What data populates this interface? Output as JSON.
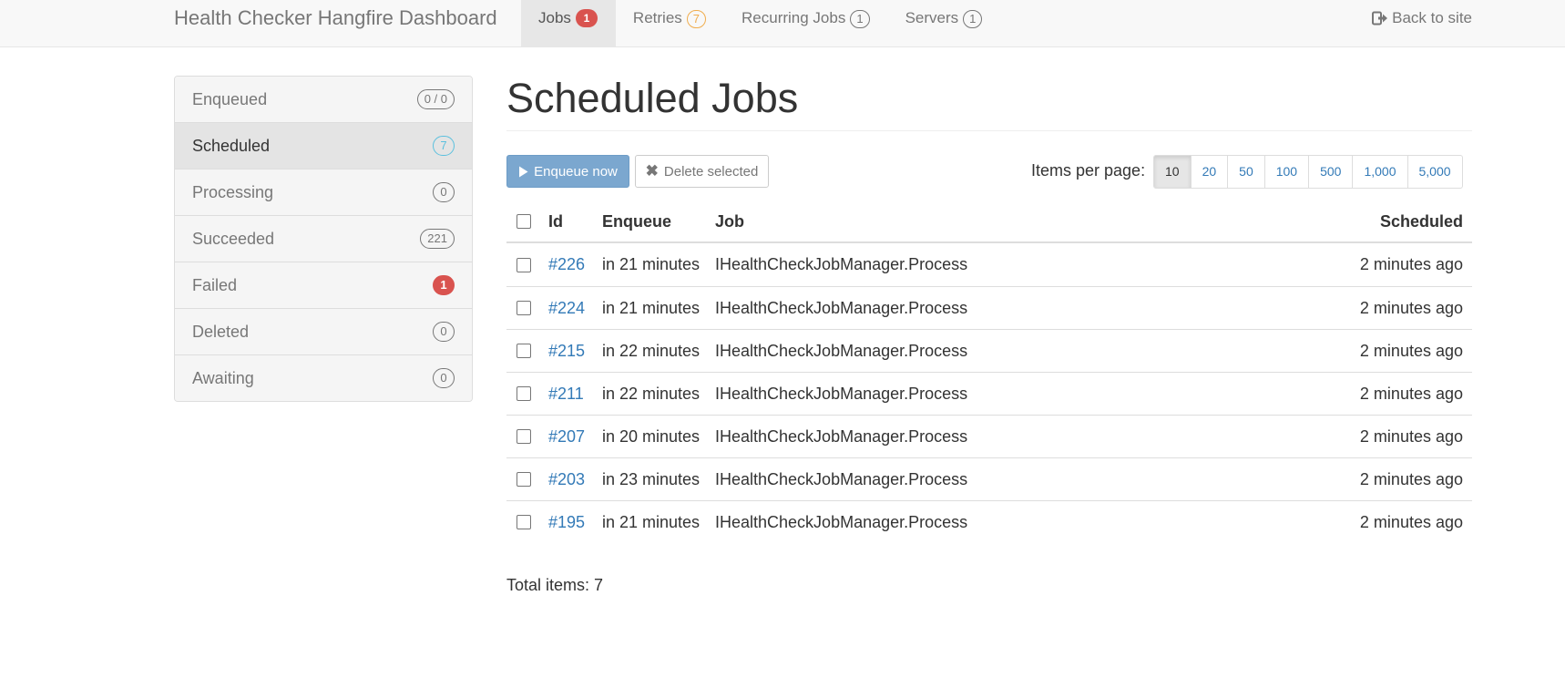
{
  "navbar": {
    "brand": "Health Checker Hangfire Dashboard",
    "links": [
      {
        "label": "Jobs",
        "badge": "1",
        "badge_style": "danger",
        "active": true
      },
      {
        "label": "Retries",
        "badge": "7",
        "badge_style": "warning",
        "active": false
      },
      {
        "label": "Recurring Jobs",
        "badge": "1",
        "badge_style": "default",
        "active": false
      },
      {
        "label": "Servers",
        "badge": "1",
        "badge_style": "default",
        "active": false
      }
    ],
    "back_link": "Back to site",
    "back_icon": "sign-out-icon"
  },
  "sidebar": {
    "items": [
      {
        "label": "Enqueued",
        "count": "0 / 0",
        "style": "default",
        "active": false
      },
      {
        "label": "Scheduled",
        "count": "7",
        "style": "info",
        "active": true
      },
      {
        "label": "Processing",
        "count": "0",
        "style": "default",
        "active": false
      },
      {
        "label": "Succeeded",
        "count": "221",
        "style": "default",
        "active": false
      },
      {
        "label": "Failed",
        "count": "1",
        "style": "danger",
        "active": false
      },
      {
        "label": "Deleted",
        "count": "0",
        "style": "default",
        "active": false
      },
      {
        "label": "Awaiting",
        "count": "0",
        "style": "default",
        "active": false
      }
    ]
  },
  "main": {
    "title": "Scheduled Jobs",
    "enqueue_button": "Enqueue now",
    "delete_button": "Delete selected",
    "items_per_page_label": "Items per page:",
    "page_sizes": [
      "10",
      "20",
      "50",
      "100",
      "500",
      "1,000",
      "5,000"
    ],
    "selected_page_size": "10",
    "table": {
      "headers": {
        "id": "Id",
        "enqueue": "Enqueue",
        "job": "Job",
        "scheduled": "Scheduled"
      },
      "rows": [
        {
          "id": "#226",
          "enqueue": "in 21 minutes",
          "job": "IHealthCheckJobManager.Process",
          "scheduled": "2 minutes ago"
        },
        {
          "id": "#224",
          "enqueue": "in 21 minutes",
          "job": "IHealthCheckJobManager.Process",
          "scheduled": "2 minutes ago"
        },
        {
          "id": "#215",
          "enqueue": "in 22 minutes",
          "job": "IHealthCheckJobManager.Process",
          "scheduled": "2 minutes ago"
        },
        {
          "id": "#211",
          "enqueue": "in 22 minutes",
          "job": "IHealthCheckJobManager.Process",
          "scheduled": "2 minutes ago"
        },
        {
          "id": "#207",
          "enqueue": "in 20 minutes",
          "job": "IHealthCheckJobManager.Process",
          "scheduled": "2 minutes ago"
        },
        {
          "id": "#203",
          "enqueue": "in 23 minutes",
          "job": "IHealthCheckJobManager.Process",
          "scheduled": "2 minutes ago"
        },
        {
          "id": "#195",
          "enqueue": "in 21 minutes",
          "job": "IHealthCheckJobManager.Process",
          "scheduled": "2 minutes ago"
        }
      ]
    },
    "total_items": "Total items: 7"
  },
  "colors": {
    "link": "#337ab7",
    "danger": "#d9534f",
    "warning": "#f0ad4e",
    "info": "#5bc0de",
    "primary_button": "#7ba7cf"
  }
}
